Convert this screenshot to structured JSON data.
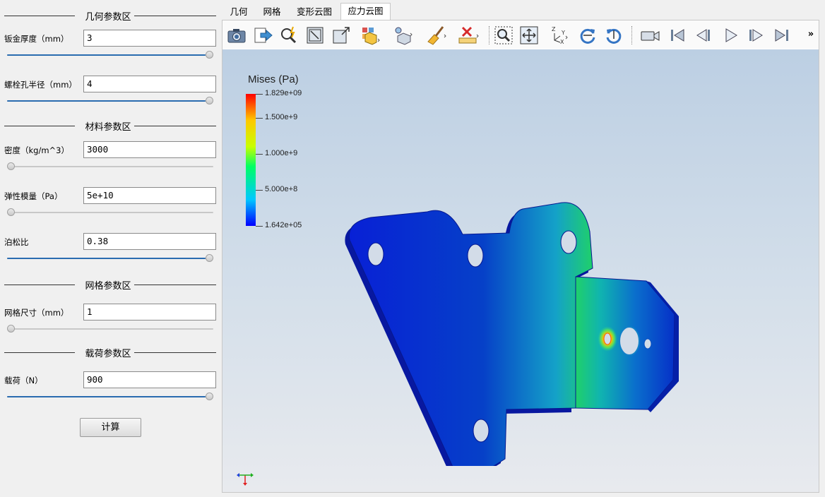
{
  "left_panel": {
    "geometry": {
      "title": "几何参数区",
      "thickness": {
        "label": "钣金厚度（mm）",
        "value": "3",
        "slider_level": 1.0
      },
      "bolt_radius": {
        "label": "螺栓孔半径（mm）",
        "value": "4",
        "slider_level": 1.0
      }
    },
    "material": {
      "title": "材料参数区",
      "density": {
        "label": "密度（kg/m^3）",
        "value": "3000",
        "slider_level": 0.0
      },
      "modulus": {
        "label": "弹性模量（Pa）",
        "value": "5e+10",
        "slider_level": 0.0
      },
      "poisson": {
        "label": "泊松比",
        "value": "0.38",
        "slider_level": 1.0
      }
    },
    "mesh": {
      "title": "网格参数区",
      "size": {
        "label": "网格尺寸（mm）",
        "value": "1",
        "slider_level": 0.0
      }
    },
    "load": {
      "title": "载荷参数区",
      "force": {
        "label": "载荷（N）",
        "value": "900",
        "slider_level": 1.0
      }
    },
    "calc_button": "计算"
  },
  "tabs": [
    {
      "label": "几何"
    },
    {
      "label": "网格"
    },
    {
      "label": "变形云图"
    },
    {
      "label": "应力云图",
      "active": true
    }
  ],
  "toolbar": {
    "icons": [
      "camera-icon",
      "export-icon",
      "magic-select-icon",
      "reset-view-icon",
      "maximize-view-icon",
      "color-map-icon",
      "render-mode-icon",
      "clean-icon",
      "ruler-clear-icon",
      "zoom-box-icon",
      "fit-view-icon",
      "axis-orientation-icon",
      "rotate-cw-icon",
      "rotate-ccw-icon",
      "record-camera-icon",
      "first-frame-icon",
      "previous-frame-icon",
      "play-icon",
      "next-frame-icon",
      "last-frame-icon"
    ],
    "overflow": "»"
  },
  "legend": {
    "title": "Mises (Pa)",
    "labels": [
      "1.829e+09",
      "1.500e+9",
      "1.000e+9",
      "5.000e+8",
      "1.642e+05"
    ],
    "label_values": [
      1829000000,
      1500000000,
      1000000000,
      500000000,
      164200
    ],
    "min": 164200,
    "max": 1829000000,
    "colors": [
      "#0000ff",
      "#00c8ff",
      "#00ff64",
      "#c8ff00",
      "#ffc800",
      "#ff0000"
    ]
  }
}
